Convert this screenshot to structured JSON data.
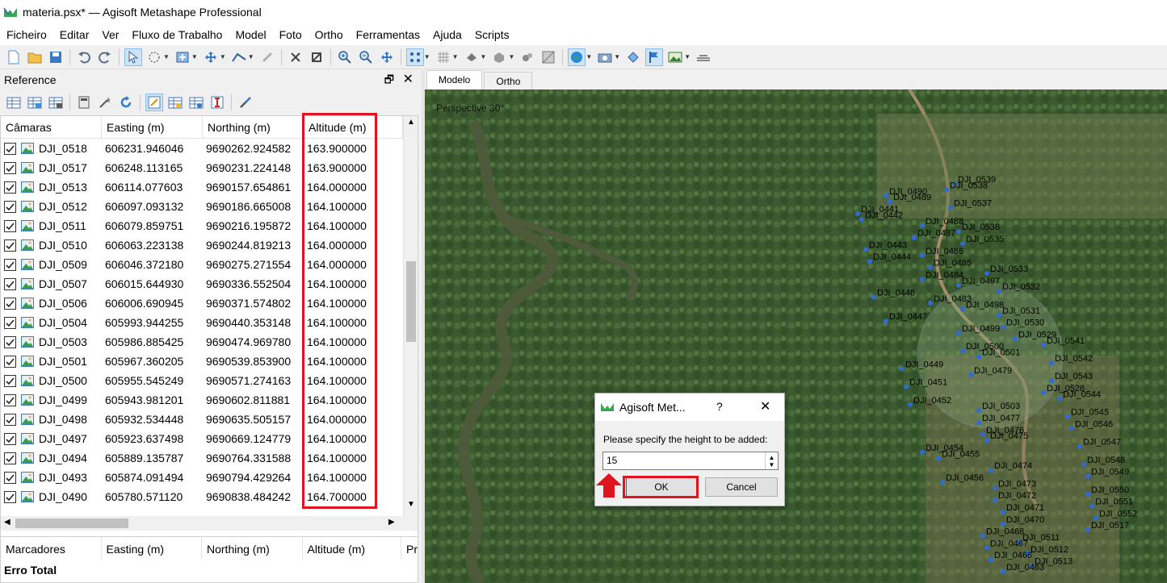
{
  "window": {
    "title": "materia.psx* — Agisoft Metashape Professional"
  },
  "menu": [
    "Ficheiro",
    "Editar",
    "Ver",
    "Fluxo de Trabalho",
    "Model",
    "Foto",
    "Ortho",
    "Ferramentas",
    "Ajuda",
    "Scripts"
  ],
  "reference_panel": {
    "title": "Reference",
    "cameras_table": {
      "columns": [
        "Câmaras",
        "Easting (m)",
        "Northing (m)",
        "Altitude (m)"
      ],
      "rows": [
        {
          "label": "DJI_0518",
          "easting": "606231.946046",
          "northing": "9690262.924582",
          "altitude": "163.900000"
        },
        {
          "label": "DJI_0517",
          "easting": "606248.113165",
          "northing": "9690231.224148",
          "altitude": "163.900000"
        },
        {
          "label": "DJI_0513",
          "easting": "606114.077603",
          "northing": "9690157.654861",
          "altitude": "164.000000"
        },
        {
          "label": "DJI_0512",
          "easting": "606097.093132",
          "northing": "9690186.665008",
          "altitude": "164.100000"
        },
        {
          "label": "DJI_0511",
          "easting": "606079.859751",
          "northing": "9690216.195872",
          "altitude": "164.100000"
        },
        {
          "label": "DJI_0510",
          "easting": "606063.223138",
          "northing": "9690244.819213",
          "altitude": "164.000000"
        },
        {
          "label": "DJI_0509",
          "easting": "606046.372180",
          "northing": "9690275.271554",
          "altitude": "164.000000"
        },
        {
          "label": "DJI_0507",
          "easting": "606015.644930",
          "northing": "9690336.552504",
          "altitude": "164.100000"
        },
        {
          "label": "DJI_0506",
          "easting": "606006.690945",
          "northing": "9690371.574802",
          "altitude": "164.100000"
        },
        {
          "label": "DJI_0504",
          "easting": "605993.944255",
          "northing": "9690440.353148",
          "altitude": "164.100000"
        },
        {
          "label": "DJI_0503",
          "easting": "605986.885425",
          "northing": "9690474.969780",
          "altitude": "164.100000"
        },
        {
          "label": "DJI_0501",
          "easting": "605967.360205",
          "northing": "9690539.853900",
          "altitude": "164.100000"
        },
        {
          "label": "DJI_0500",
          "easting": "605955.545249",
          "northing": "9690571.274163",
          "altitude": "164.100000"
        },
        {
          "label": "DJI_0499",
          "easting": "605943.981201",
          "northing": "9690602.811881",
          "altitude": "164.100000"
        },
        {
          "label": "DJI_0498",
          "easting": "605932.534448",
          "northing": "9690635.505157",
          "altitude": "164.000000"
        },
        {
          "label": "DJI_0497",
          "easting": "605923.637498",
          "northing": "9690669.124779",
          "altitude": "164.100000"
        },
        {
          "label": "DJI_0494",
          "easting": "605889.135787",
          "northing": "9690764.331588",
          "altitude": "164.100000"
        },
        {
          "label": "DJI_0493",
          "easting": "605874.091494",
          "northing": "9690794.429264",
          "altitude": "164.100000"
        },
        {
          "label": "DJI_0490",
          "easting": "605780.571120",
          "northing": "9690838.484242",
          "altitude": "164.700000"
        }
      ]
    },
    "markers_table": {
      "columns": [
        "Marcadores",
        "Easting (m)",
        "Northing (m)",
        "Altitude (m)",
        "Pr"
      ],
      "total_label": "Erro Total"
    }
  },
  "view": {
    "tabs": [
      "Modelo",
      "Ortho"
    ],
    "active_tab": "Modelo",
    "perspective_label": "Perspective 30°",
    "camera_labels": [
      "DJI_0539",
      "DJI_0538",
      "DJI_0490",
      "DJI_0489",
      "DJI_0537",
      "DJI_0441",
      "DJI_0442",
      "DJI_0488",
      "DJI_0536",
      "DJI_0487",
      "DJI_0535",
      "DJI_0443",
      "DJI_0486",
      "DJI_0444",
      "DJI_0485",
      "DJI_0533",
      "DJI_0484",
      "DJI_0497",
      "DJI_0532",
      "DJI_0446",
      "DJI_0483",
      "DJI_0498",
      "DJI_0531",
      "DJI_0447",
      "DJI_0530",
      "DJI_0499",
      "DJI_0529",
      "DJI_0541",
      "DJI_0500",
      "DJI_0501",
      "DJI_0542",
      "DJI_0449",
      "DJI_0479",
      "DJI_0543",
      "DJI_0451",
      "DJI_0528",
      "DJI_0544",
      "DJI_0452",
      "DJI_0503",
      "DJI_0545",
      "DJI_0477",
      "DJI_0546",
      "DJI_0476",
      "DJI_0475",
      "DJI_0547",
      "DJI_0454",
      "DJI_0455",
      "DJI_0548",
      "DJI_0474",
      "DJI_0549",
      "DJI_0456",
      "DJI_0473",
      "DJI_0550",
      "DJI_0472",
      "DJI_0551",
      "DJI_0471",
      "DJI_0552",
      "DJI_0470",
      "DJI_0517",
      "DJI_0468",
      "DJI_0511",
      "DJI_0467",
      "DJI_0512",
      "DJI_0466",
      "DJI_0513",
      "DJI_0463"
    ]
  },
  "dialog": {
    "title": "Agisoft Met...",
    "help": "?",
    "prompt": "Please specify the height to be added:",
    "value": "15",
    "ok_label": "OK",
    "cancel_label": "Cancel"
  },
  "colors": {
    "highlight": "#e0141e",
    "camera_point": "#2f6bd6"
  }
}
